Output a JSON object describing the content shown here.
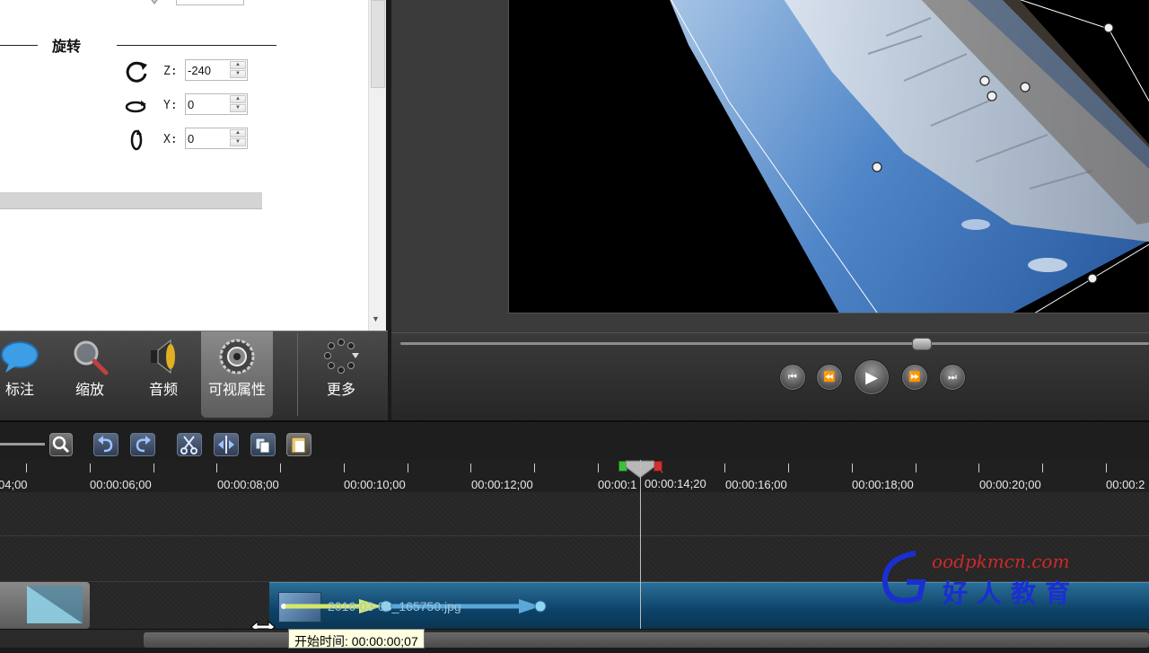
{
  "properties": {
    "section_title": "旋转",
    "rotation": [
      {
        "axis": "Z:",
        "value": "-240"
      },
      {
        "axis": "Y:",
        "value": "0"
      },
      {
        "axis": "X:",
        "value": "0"
      }
    ]
  },
  "tabs": [
    {
      "label": "标注",
      "icon": "callout-bubble-icon"
    },
    {
      "label": "缩放",
      "icon": "magnifier-icon"
    },
    {
      "label": "音频",
      "icon": "speaker-icon"
    },
    {
      "label": "可视属性",
      "icon": "visual-properties-icon",
      "active": true
    },
    {
      "label": "更多",
      "icon": "more-dots-icon"
    }
  ],
  "timeline": {
    "ruler": [
      {
        "label": "04;00"
      },
      {
        "label": "00:00:06;00"
      },
      {
        "label": "00:00:08;00"
      },
      {
        "label": "00:00:10;00"
      },
      {
        "label": "00:00:12;00"
      },
      {
        "label": "00:00:1"
      },
      {
        "label": "00:00:16;00"
      },
      {
        "label": "00:00:18;00"
      },
      {
        "label": "00:00:20;00"
      },
      {
        "label": "00:00:2"
      }
    ],
    "playhead_time": "00:00:14;20",
    "clip_name": "2016-03-08_165750.jpg",
    "tooltip_label": "开始时间:",
    "tooltip_value": "00:00:00;07"
  },
  "watermark": {
    "site": "oodpkmcn.com",
    "brand_text": "好人教育"
  },
  "colors": {
    "accent_blue": "#0d4268",
    "play_green": "#3cbf3c",
    "play_red": "#d03030"
  }
}
